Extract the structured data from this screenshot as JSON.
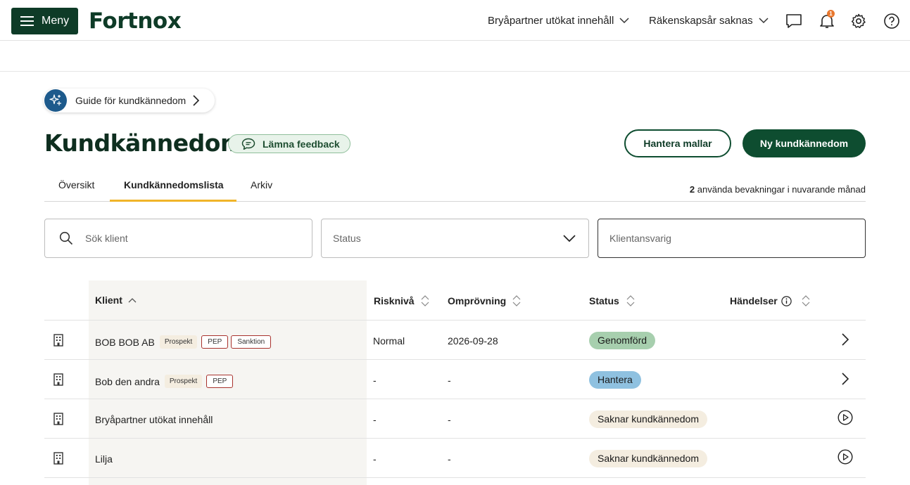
{
  "topbar": {
    "menu_label": "Meny",
    "logo": "Fortnox",
    "company_dropdown": "Bryåpartner utökat innehåll",
    "year_dropdown": "Räkenskapsår saknas",
    "notification_count": "1"
  },
  "guide": {
    "label": "Guide för kundkännedom"
  },
  "page": {
    "title": "Kundkännedom",
    "feedback_label": "Lämna feedback",
    "manage_templates_label": "Hantera mallar",
    "new_label": "Ny kundkännedom"
  },
  "tabs": [
    {
      "label": "Översikt",
      "active": false
    },
    {
      "label": "Kundkännedomslista",
      "active": true
    },
    {
      "label": "Arkiv",
      "active": false
    }
  ],
  "usage": {
    "count": "2",
    "text": "använda bevakningar i nuvarande månad"
  },
  "filters": {
    "search_placeholder": "Sök klient",
    "status_placeholder": "Status",
    "responsible_placeholder": "Klientansvarig"
  },
  "table": {
    "headers": {
      "client": "Klient",
      "risk": "Risknivå",
      "review": "Omprövning",
      "status": "Status",
      "events": "Händelser"
    },
    "rows": [
      {
        "client": "BOB BOB AB",
        "tags": [
          "Prospekt",
          "PEP",
          "Sanktion"
        ],
        "risk": "Normal",
        "review": "2026-09-28",
        "status": "Genomförd",
        "status_color": "#a7cfae",
        "action": "chevron"
      },
      {
        "client": "Bob den andra",
        "tags": [
          "Prospekt",
          "PEP"
        ],
        "risk": "-",
        "review": "-",
        "status": "Hantera",
        "status_color": "#8fc1e0",
        "action": "chevron"
      },
      {
        "client": "Bryåpartner utökat innehåll",
        "tags": [],
        "risk": "-",
        "review": "-",
        "status": "Saknar kundkännedom",
        "status_color": "#f4ede0",
        "action": "play"
      },
      {
        "client": "Lilja",
        "tags": [],
        "risk": "-",
        "review": "-",
        "status": "Saknar kundkännedom",
        "status_color": "#f4ede0",
        "action": "play"
      }
    ]
  }
}
